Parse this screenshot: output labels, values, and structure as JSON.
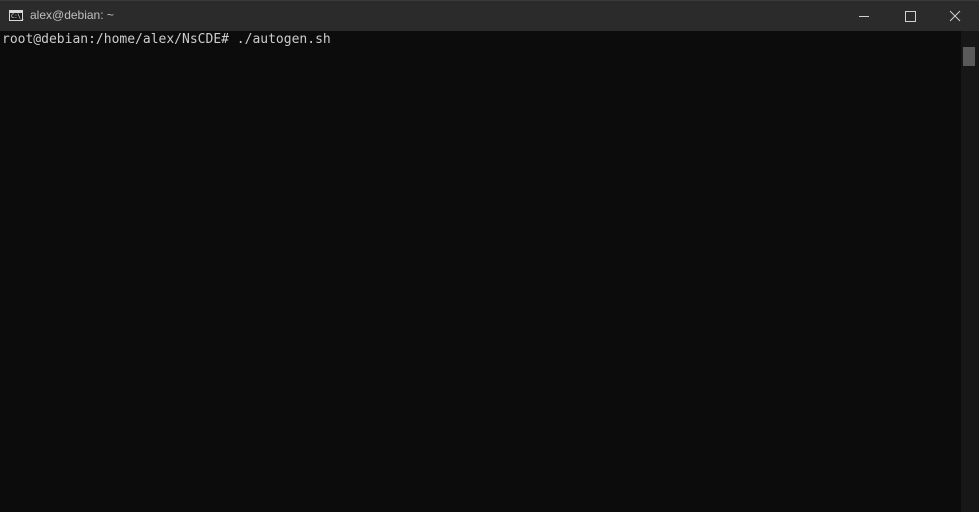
{
  "window": {
    "title": "alex@debian: ~",
    "icon": "console-icon",
    "icon_glyph": "C:\\_",
    "controls": [
      "minimize-icon",
      "maximize-icon",
      "close-icon"
    ]
  },
  "terminal": {
    "lines": [
      "root@debian:/home/alex/NsCDE# ./autogen.sh"
    ],
    "colors": {
      "background": "#0c0c0c",
      "foreground": "#cccccc",
      "titlebar": "#2b2b2b"
    }
  },
  "scrollbar": {
    "thumb_position": 0.0
  }
}
